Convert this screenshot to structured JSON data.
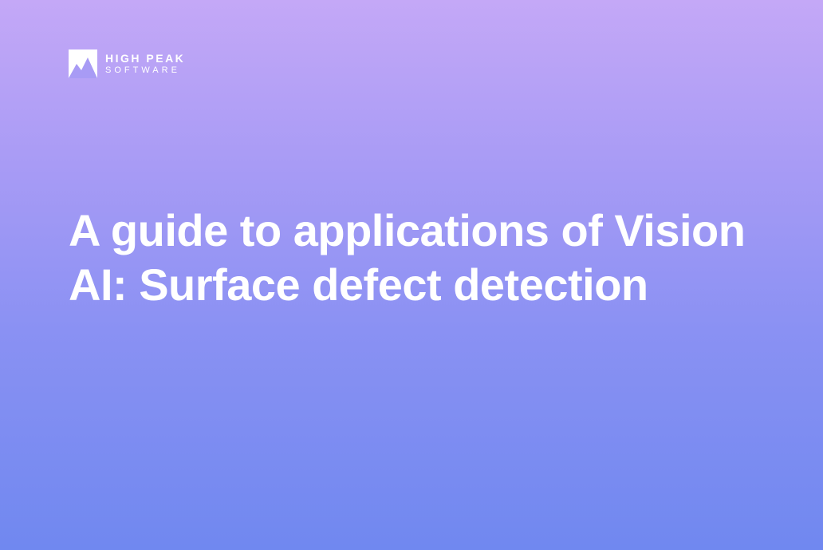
{
  "logo": {
    "brand_top": "HIGH PEAK",
    "brand_bottom": "SOFTWARE"
  },
  "heading": "A guide to applications of Vision AI: Surface defect detection"
}
